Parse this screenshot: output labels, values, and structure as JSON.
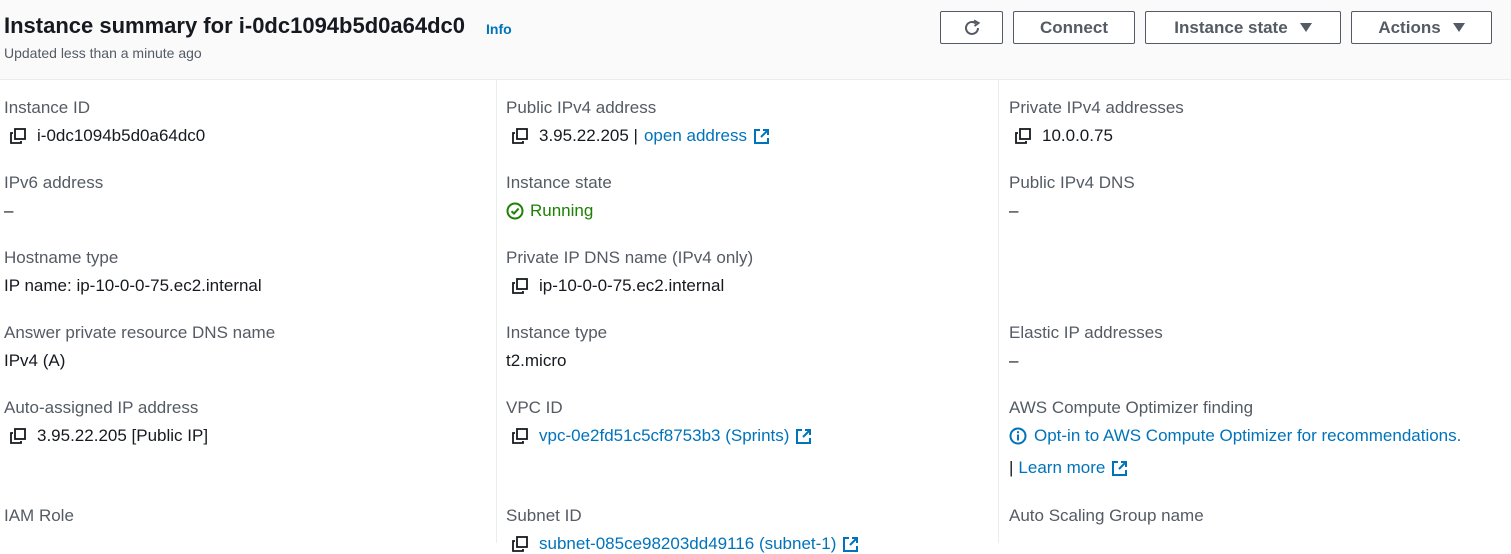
{
  "header": {
    "title": "Instance summary for i-0dc1094b5d0a64dc0",
    "info_label": "Info",
    "subtitle": "Updated less than a minute ago",
    "connect_label": "Connect",
    "instance_state_label": "Instance state",
    "actions_label": "Actions"
  },
  "fields": {
    "instance_id": {
      "label": "Instance ID",
      "value": "i-0dc1094b5d0a64dc0"
    },
    "public_ipv4": {
      "label": "Public IPv4 address",
      "value": "3.95.22.205 |",
      "link": "open address"
    },
    "private_ipv4": {
      "label": "Private IPv4 addresses",
      "value": "10.0.0.75"
    },
    "ipv6": {
      "label": "IPv6 address",
      "value": "–"
    },
    "instance_state": {
      "label": "Instance state",
      "value": "Running"
    },
    "public_dns": {
      "label": "Public IPv4 DNS",
      "value": "–"
    },
    "hostname_type": {
      "label": "Hostname type",
      "value": "IP name: ip-10-0-0-75.ec2.internal"
    },
    "private_dns": {
      "label": "Private IP DNS name (IPv4 only)",
      "value": "ip-10-0-0-75.ec2.internal"
    },
    "answer_dns": {
      "label": "Answer private resource DNS name",
      "value": "IPv4 (A)"
    },
    "instance_type": {
      "label": "Instance type",
      "value": "t2.micro"
    },
    "elastic_ip": {
      "label": "Elastic IP addresses",
      "value": "–"
    },
    "auto_ip": {
      "label": "Auto-assigned IP address",
      "value": "3.95.22.205 [Public IP]"
    },
    "vpc_id": {
      "label": "VPC ID",
      "value": "vpc-0e2fd51c5cf8753b3 (Sprints)"
    },
    "optimizer": {
      "label": "AWS Compute Optimizer finding",
      "value": "Opt-in to AWS Compute Optimizer for recommendations.",
      "separator": "|",
      "learn_more": "Learn more"
    },
    "iam_role": {
      "label": "IAM Role"
    },
    "subnet_id": {
      "label": "Subnet ID",
      "value": "subnet-085ce98203dd49116 (subnet-1)"
    },
    "asg_name": {
      "label": "Auto Scaling Group name"
    }
  },
  "colors": {
    "link": "#0073bb",
    "running": "#1d8102",
    "label": "#545b64",
    "text": "#16191f"
  },
  "icons": {
    "copy": "copy-icon",
    "external": "external-link-icon",
    "refresh": "refresh-icon",
    "status": "check-circle-icon",
    "info": "info-circle-icon"
  }
}
